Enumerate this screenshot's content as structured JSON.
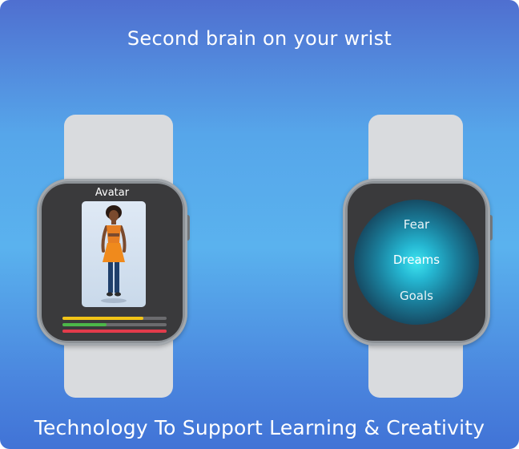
{
  "header": {
    "title": "Second brain on your wrist"
  },
  "footer": {
    "tagline": "Technology To Support Learning & Creativity"
  },
  "watch_left": {
    "screen_title": "Avatar",
    "bars": [
      {
        "name": "yellow",
        "color": "#f2c417",
        "level": 0.78
      },
      {
        "name": "green",
        "color": "#4cb749",
        "level": 0.42
      },
      {
        "name": "red",
        "color": "#e23b4b",
        "level": 1.0
      }
    ]
  },
  "watch_right": {
    "menu": [
      {
        "label": "Fear"
      },
      {
        "label": "Dreams"
      },
      {
        "label": "Goals"
      }
    ]
  },
  "colors": {
    "strap": "#d9dbde",
    "case": "#8c9196",
    "screen": "#3a3a3c",
    "glow_core": "#3ee5f0"
  }
}
